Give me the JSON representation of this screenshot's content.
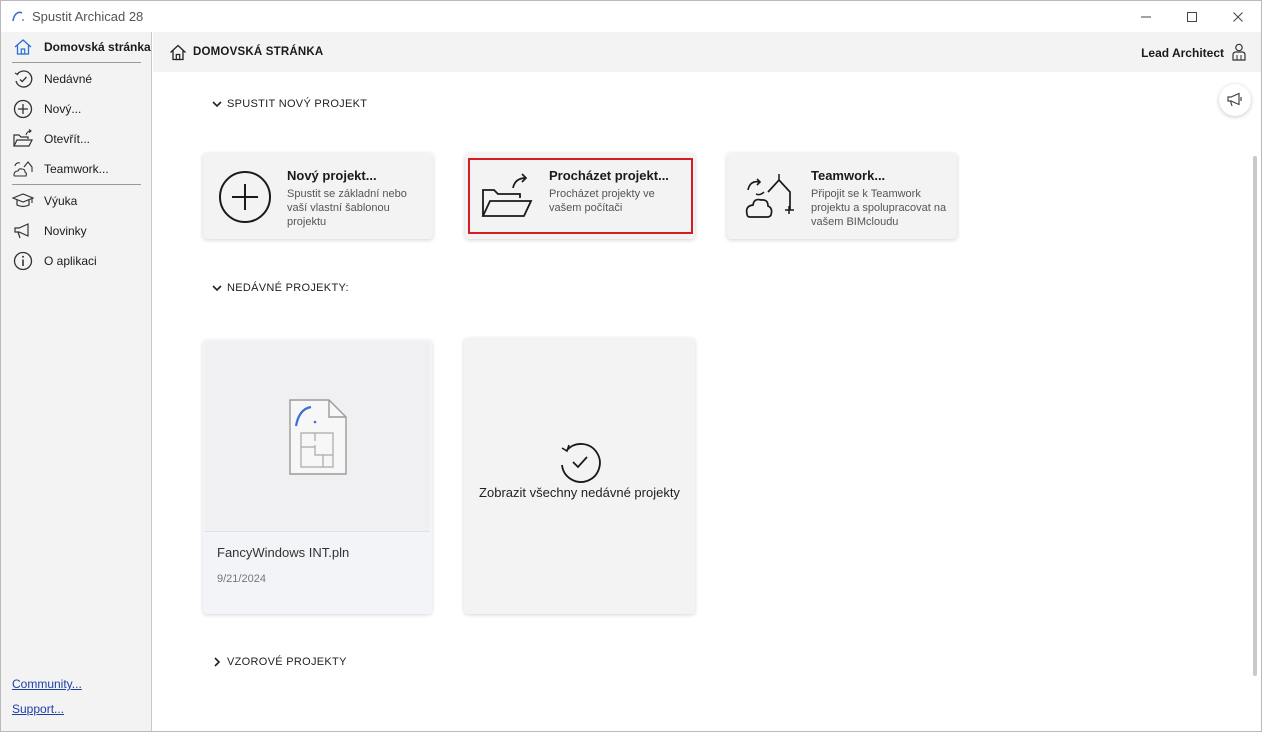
{
  "window": {
    "title": "Spustit Archicad 28"
  },
  "sidebar": {
    "items": [
      {
        "label": "Domovská stránka",
        "icon": "home-icon"
      },
      {
        "label": "Nedávné",
        "icon": "recent-icon"
      },
      {
        "label": "Nový...",
        "icon": "plus-circle-icon"
      },
      {
        "label": "Otevřít...",
        "icon": "folder-open-icon"
      },
      {
        "label": "Teamwork...",
        "icon": "teamwork-icon"
      },
      {
        "label": "Výuka",
        "icon": "graduation-cap-icon"
      },
      {
        "label": "Novinky",
        "icon": "megaphone-icon"
      },
      {
        "label": "O aplikaci",
        "icon": "info-icon"
      }
    ],
    "links": {
      "community": "Community...",
      "support": "Support..."
    }
  },
  "header": {
    "title": "DOMOVSKÁ STRÁNKA",
    "user": "Lead Architect"
  },
  "sections": {
    "new_project": "SPUSTIT NOVÝ PROJEKT",
    "recent_projects": "NEDÁVNÉ PROJEKTY:",
    "sample_projects": "VZOROVÉ PROJEKTY"
  },
  "actions": [
    {
      "title": "Nový projekt...",
      "desc": "Spustit se základní nebo vaší vlastní šablonou projektu",
      "icon": "plus-circle-icon"
    },
    {
      "title": "Procházet projekt...",
      "desc": "Procházet projekty ve vašem počítači",
      "icon": "folder-open-icon"
    },
    {
      "title": "Teamwork...",
      "desc": "Připojit se k Teamwork projektu a spolupracovat na vašem BIMcloudu",
      "icon": "teamwork-icon"
    }
  ],
  "recent": {
    "file_name": "FancyWindows INT.pln",
    "file_date": "9/21/2024",
    "show_all": "Zobrazit všechny nedávné projekty"
  },
  "colors": {
    "highlight": "#d81b23",
    "link": "#1a3fa8",
    "active_icon": "#2a6edb"
  }
}
